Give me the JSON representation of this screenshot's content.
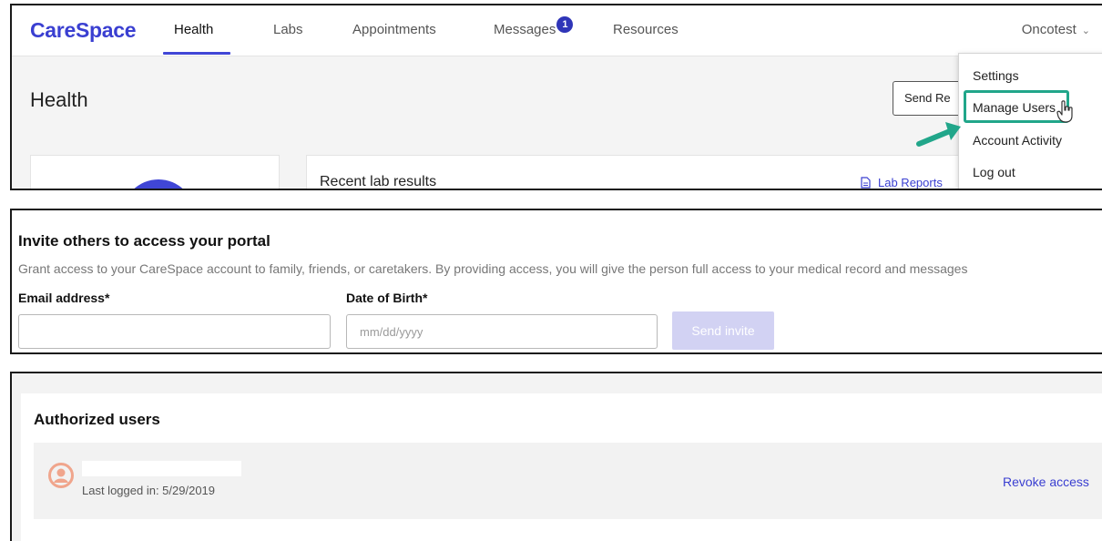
{
  "nav": {
    "logo": "CareSpace",
    "tabs": [
      "Health",
      "Labs",
      "Appointments",
      "Messages",
      "Resources"
    ],
    "messages_badge": "1",
    "user_name": "Oncotest"
  },
  "dropdown": {
    "items": [
      "Settings",
      "Manage Users",
      "Account Activity",
      "Log out"
    ],
    "highlighted": "Manage Users"
  },
  "health": {
    "title": "Health",
    "send_button": "Send Re",
    "recent_lab_title": "Recent lab results",
    "lab_reports_link": "Lab Reports"
  },
  "invite": {
    "title": "Invite others to access your portal",
    "description": "Grant access to your CareSpace account to family, friends, or caretakers. By providing access, you will give the person full access to your medical record and messages",
    "email_label": "Email address*",
    "email_value": "",
    "dob_label": "Date of Birth*",
    "dob_placeholder": "mm/dd/yyyy",
    "send_button": "Send invite"
  },
  "authorized": {
    "title": "Authorized users",
    "users": [
      {
        "name": "",
        "last_logged_in": "Last logged in: 5/29/2019",
        "action": "Revoke access"
      }
    ]
  },
  "colors": {
    "brand": "#3a3fd1",
    "highlight": "#21a68a",
    "user_icon": "#f0a58c",
    "disabled_button": "#d2d2f3"
  }
}
